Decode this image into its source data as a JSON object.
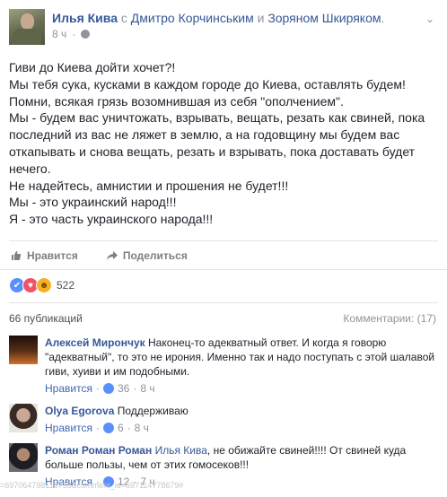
{
  "post": {
    "author": "Илья Кива",
    "with_word": "с",
    "tagged": [
      "Дмитро Корчинським",
      "Зоряном Шкиряком"
    ],
    "and_word": "и",
    "trailing": ".",
    "time": "8 ч",
    "menu_icon": "chevron-down-icon",
    "lines": [
      "Гиви до Киева дойти хочет?!",
      "Мы тебя сука, кусками в каждом городе до Киева, оставлять будем!",
      "Помни, всякая грязь возомнившая из себя \"ополчением\".",
      "Мы - будем вас уничтожать, взрывать, вещать, резать как свиней, пока",
      "последний из вас не ляжет в землю, а на годовщину мы будем вас",
      "откапывать и снова вещать, резать и взрывать, пока доставать будет",
      "нечего.",
      "Не надейтесь, амнистии и прошения не будет!!!",
      "Мы - это украинский народ!!!",
      "Я - это часть украинского народа!!!"
    ]
  },
  "actions": {
    "like": "Нравится",
    "share": "Поделиться"
  },
  "reactions": {
    "count": "522"
  },
  "publications": "66 публикаций",
  "comments_count": "Комментарии: (17)",
  "comments": [
    {
      "name": "Алексей Мирончук",
      "text": "Наконец-то адекватный ответ. И когда я говорю \"адекватный\", то это не ирония. Именно так и надо поступать с этой шалавой гиви, хуиви и им подобными.",
      "like": "Нравится",
      "likes": "36",
      "time": "8 ч"
    },
    {
      "name": "Olya Egorova",
      "text": "Поддерживаю",
      "like": "Нравится",
      "likes": "6",
      "time": "8 ч"
    },
    {
      "name": "Роман Роман Роман",
      "mention": "Илья Кива",
      "text": ", не обижайте свиней!!!! От свиней куда больше пользы, чем от этих гомосеков!!!",
      "like": "Нравится",
      "likes": "12",
      "time": "7 ч"
    }
  ],
  "footer": "=697064798116733&comment_id=697114778679#"
}
